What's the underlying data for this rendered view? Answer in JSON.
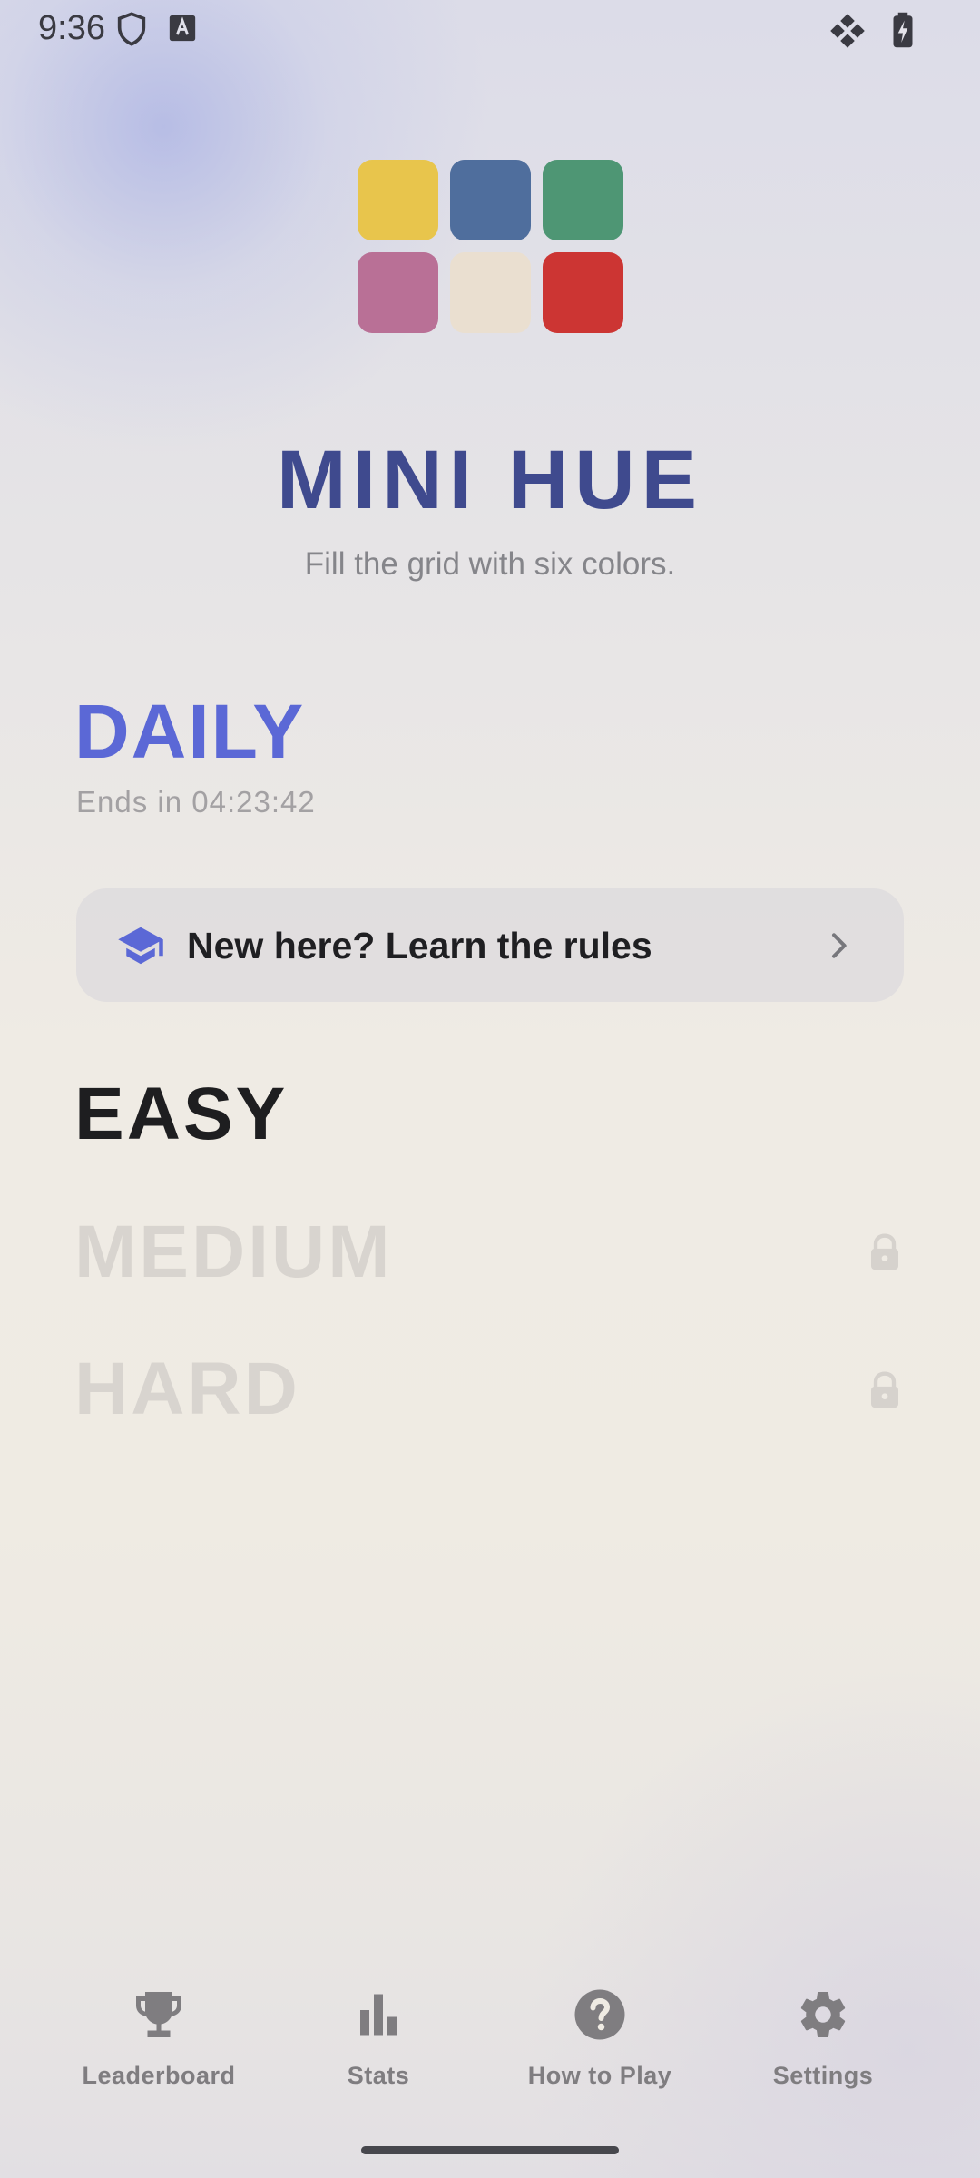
{
  "status_bar": {
    "time": "9:36",
    "left_icons": [
      "shield-icon",
      "font-a-icon"
    ],
    "right_icons": [
      "satellite-icon",
      "battery-charging-icon"
    ]
  },
  "logo": {
    "tiles": [
      "#e8c54c",
      "#4f6e9d",
      "#4e9674",
      "#b97096",
      "#eadfd0",
      "#cc3533"
    ]
  },
  "header": {
    "title": "MINI HUE",
    "subtitle": "Fill the grid with six colors."
  },
  "daily": {
    "title": "DAILY",
    "countdown": "Ends in 04:23:42"
  },
  "rules_card": {
    "label": "New here? Learn the rules",
    "icon": "graduation-cap-icon"
  },
  "levels": [
    {
      "label": "EASY",
      "locked": false
    },
    {
      "label": "MEDIUM",
      "locked": true
    },
    {
      "label": "HARD",
      "locked": true
    }
  ],
  "bottom_nav": [
    {
      "label": "Leaderboard",
      "icon": "trophy-icon"
    },
    {
      "label": "Stats",
      "icon": "bar-chart-icon"
    },
    {
      "label": "How to Play",
      "icon": "help-circle-icon"
    },
    {
      "label": "Settings",
      "icon": "gear-icon"
    }
  ],
  "colors": {
    "title": "#3f4a8e",
    "daily": "#5b68d6",
    "locked_text": "#d8d4cf"
  }
}
